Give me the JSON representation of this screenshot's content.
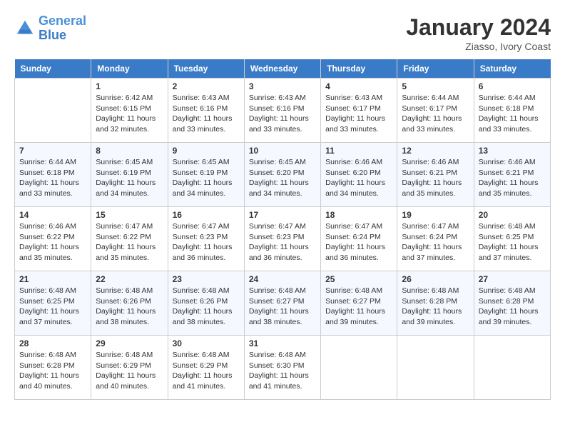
{
  "header": {
    "logo_line1": "General",
    "logo_line2": "Blue",
    "month_year": "January 2024",
    "location": "Ziasso, Ivory Coast"
  },
  "days_of_week": [
    "Sunday",
    "Monday",
    "Tuesday",
    "Wednesday",
    "Thursday",
    "Friday",
    "Saturday"
  ],
  "weeks": [
    [
      {
        "num": "",
        "info": ""
      },
      {
        "num": "1",
        "info": "Sunrise: 6:42 AM\nSunset: 6:15 PM\nDaylight: 11 hours\nand 32 minutes."
      },
      {
        "num": "2",
        "info": "Sunrise: 6:43 AM\nSunset: 6:16 PM\nDaylight: 11 hours\nand 33 minutes."
      },
      {
        "num": "3",
        "info": "Sunrise: 6:43 AM\nSunset: 6:16 PM\nDaylight: 11 hours\nand 33 minutes."
      },
      {
        "num": "4",
        "info": "Sunrise: 6:43 AM\nSunset: 6:17 PM\nDaylight: 11 hours\nand 33 minutes."
      },
      {
        "num": "5",
        "info": "Sunrise: 6:44 AM\nSunset: 6:17 PM\nDaylight: 11 hours\nand 33 minutes."
      },
      {
        "num": "6",
        "info": "Sunrise: 6:44 AM\nSunset: 6:18 PM\nDaylight: 11 hours\nand 33 minutes."
      }
    ],
    [
      {
        "num": "7",
        "info": "Sunrise: 6:44 AM\nSunset: 6:18 PM\nDaylight: 11 hours\nand 33 minutes."
      },
      {
        "num": "8",
        "info": "Sunrise: 6:45 AM\nSunset: 6:19 PM\nDaylight: 11 hours\nand 34 minutes."
      },
      {
        "num": "9",
        "info": "Sunrise: 6:45 AM\nSunset: 6:19 PM\nDaylight: 11 hours\nand 34 minutes."
      },
      {
        "num": "10",
        "info": "Sunrise: 6:45 AM\nSunset: 6:20 PM\nDaylight: 11 hours\nand 34 minutes."
      },
      {
        "num": "11",
        "info": "Sunrise: 6:46 AM\nSunset: 6:20 PM\nDaylight: 11 hours\nand 34 minutes."
      },
      {
        "num": "12",
        "info": "Sunrise: 6:46 AM\nSunset: 6:21 PM\nDaylight: 11 hours\nand 35 minutes."
      },
      {
        "num": "13",
        "info": "Sunrise: 6:46 AM\nSunset: 6:21 PM\nDaylight: 11 hours\nand 35 minutes."
      }
    ],
    [
      {
        "num": "14",
        "info": "Sunrise: 6:46 AM\nSunset: 6:22 PM\nDaylight: 11 hours\nand 35 minutes."
      },
      {
        "num": "15",
        "info": "Sunrise: 6:47 AM\nSunset: 6:22 PM\nDaylight: 11 hours\nand 35 minutes."
      },
      {
        "num": "16",
        "info": "Sunrise: 6:47 AM\nSunset: 6:23 PM\nDaylight: 11 hours\nand 36 minutes."
      },
      {
        "num": "17",
        "info": "Sunrise: 6:47 AM\nSunset: 6:23 PM\nDaylight: 11 hours\nand 36 minutes."
      },
      {
        "num": "18",
        "info": "Sunrise: 6:47 AM\nSunset: 6:24 PM\nDaylight: 11 hours\nand 36 minutes."
      },
      {
        "num": "19",
        "info": "Sunrise: 6:47 AM\nSunset: 6:24 PM\nDaylight: 11 hours\nand 37 minutes."
      },
      {
        "num": "20",
        "info": "Sunrise: 6:48 AM\nSunset: 6:25 PM\nDaylight: 11 hours\nand 37 minutes."
      }
    ],
    [
      {
        "num": "21",
        "info": "Sunrise: 6:48 AM\nSunset: 6:25 PM\nDaylight: 11 hours\nand 37 minutes."
      },
      {
        "num": "22",
        "info": "Sunrise: 6:48 AM\nSunset: 6:26 PM\nDaylight: 11 hours\nand 38 minutes."
      },
      {
        "num": "23",
        "info": "Sunrise: 6:48 AM\nSunset: 6:26 PM\nDaylight: 11 hours\nand 38 minutes."
      },
      {
        "num": "24",
        "info": "Sunrise: 6:48 AM\nSunset: 6:27 PM\nDaylight: 11 hours\nand 38 minutes."
      },
      {
        "num": "25",
        "info": "Sunrise: 6:48 AM\nSunset: 6:27 PM\nDaylight: 11 hours\nand 39 minutes."
      },
      {
        "num": "26",
        "info": "Sunrise: 6:48 AM\nSunset: 6:28 PM\nDaylight: 11 hours\nand 39 minutes."
      },
      {
        "num": "27",
        "info": "Sunrise: 6:48 AM\nSunset: 6:28 PM\nDaylight: 11 hours\nand 39 minutes."
      }
    ],
    [
      {
        "num": "28",
        "info": "Sunrise: 6:48 AM\nSunset: 6:28 PM\nDaylight: 11 hours\nand 40 minutes."
      },
      {
        "num": "29",
        "info": "Sunrise: 6:48 AM\nSunset: 6:29 PM\nDaylight: 11 hours\nand 40 minutes."
      },
      {
        "num": "30",
        "info": "Sunrise: 6:48 AM\nSunset: 6:29 PM\nDaylight: 11 hours\nand 41 minutes."
      },
      {
        "num": "31",
        "info": "Sunrise: 6:48 AM\nSunset: 6:30 PM\nDaylight: 11 hours\nand 41 minutes."
      },
      {
        "num": "",
        "info": ""
      },
      {
        "num": "",
        "info": ""
      },
      {
        "num": "",
        "info": ""
      }
    ]
  ]
}
